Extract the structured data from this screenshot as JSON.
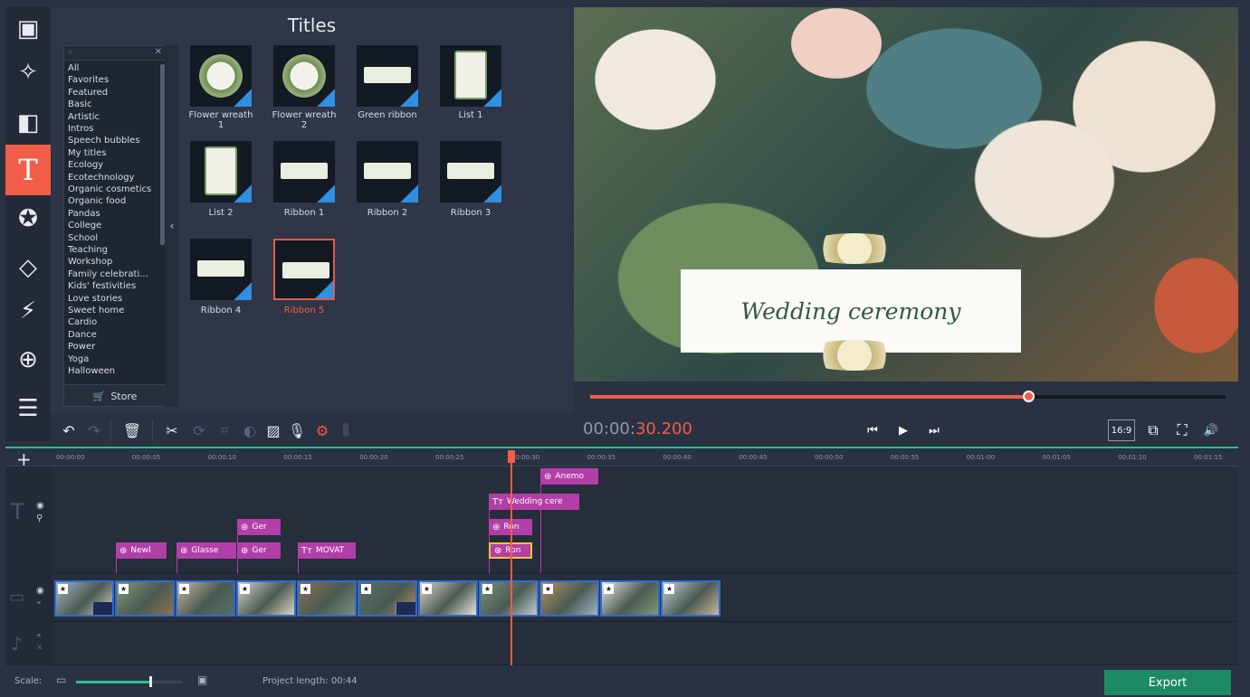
{
  "left_rail": {
    "items": [
      {
        "icon": "import-media-icon",
        "glyph": "▣"
      },
      {
        "icon": "magic-wand-icon",
        "glyph": "✧"
      },
      {
        "icon": "filters-icon",
        "glyph": "◧"
      },
      {
        "icon": "titles-icon",
        "glyph": "T",
        "active": true
      },
      {
        "icon": "stickers-icon",
        "glyph": "✪"
      },
      {
        "icon": "transitions-icon",
        "glyph": "◇"
      },
      {
        "icon": "motion-icon",
        "glyph": "⚡"
      },
      {
        "icon": "zoom-icon",
        "glyph": "⊕"
      },
      {
        "icon": "more-tools-icon",
        "glyph": "☰"
      }
    ]
  },
  "titles_panel": {
    "title": "Titles",
    "categories": [
      "All",
      "Favorites",
      "Featured",
      "Basic",
      "Artistic",
      "Intros",
      "Speech bubbles",
      "My titles",
      "Ecology",
      "Ecotechnology",
      "Organic cosmetics",
      "Organic food",
      "Pandas",
      "College",
      "School",
      "Teaching",
      "Workshop",
      "Family celebrati...",
      "Kids' festivities",
      "Love stories",
      "Sweet home",
      "Cardio",
      "Dance",
      "Power",
      "Yoga",
      "Halloween"
    ],
    "store_label": "Store",
    "collapse_glyph": "‹",
    "tiles": [
      {
        "label": "Flower wreath 1",
        "art": "wreath",
        "new": true
      },
      {
        "label": "Flower wreath 2",
        "art": "wreath",
        "new": true
      },
      {
        "label": "Green ribbon",
        "art": "ribbon",
        "new": true
      },
      {
        "label": "List 1",
        "art": "list",
        "new": true
      },
      {
        "label": "List 2",
        "art": "list",
        "new": true
      },
      {
        "label": "Ribbon 1",
        "art": "ribbon",
        "new": true
      },
      {
        "label": "Ribbon 2",
        "art": "ribbon",
        "new": true
      },
      {
        "label": "Ribbon 3",
        "art": "ribbon",
        "new": true
      },
      {
        "label": "Ribbon 4",
        "art": "ribbon",
        "new": true
      },
      {
        "label": "Ribbon 5",
        "art": "ribbon",
        "new": true,
        "selected": true
      }
    ]
  },
  "preview": {
    "title_text": "Wedding ceremony",
    "progress": 0.69
  },
  "toolbar": {
    "buttons": [
      {
        "name": "undo-icon",
        "glyph": "↶"
      },
      {
        "name": "redo-icon",
        "glyph": "↷",
        "dim": true
      },
      {
        "name": "delete-icon",
        "glyph": "🗑"
      },
      {
        "name": "cut-icon",
        "glyph": "✂",
        "sep": true
      },
      {
        "name": "rotate-icon",
        "glyph": "⟳",
        "dim": true
      },
      {
        "name": "crop-icon",
        "glyph": "⌗",
        "dim": true
      },
      {
        "name": "color-adjust-icon",
        "glyph": "◐",
        "dim": true
      },
      {
        "name": "image-icon",
        "glyph": "▨"
      },
      {
        "name": "microphone-icon",
        "glyph": "🎙"
      },
      {
        "name": "settings-gear-icon",
        "glyph": "⚙",
        "accent": true
      },
      {
        "name": "equalizer-icon",
        "glyph": "⫼",
        "dim": true
      }
    ]
  },
  "player": {
    "timecode_prefix": "00:00:",
    "timecode_highlight": "30.200",
    "prev_glyph": "⏮",
    "play_glyph": "▶",
    "next_glyph": "⏭",
    "aspect": "16:9",
    "detach_glyph": "⧉",
    "fullscreen_glyph": "⛶",
    "volume_glyph": "🔊"
  },
  "timeline": {
    "add_glyph": "+",
    "ruler_ticks": [
      "00:00:00",
      "00:00:05",
      "00:00:10",
      "00:00:15",
      "00:00:20",
      "00:00:25",
      "00:00:30",
      "00:00:35",
      "00:00:40",
      "00:00:45",
      "00:00:50",
      "00:00:55",
      "00:01:00",
      "00:01:05",
      "00:01:10",
      "00:01:15"
    ],
    "title_clips": [
      {
        "text": "Anemo",
        "kind": "sticker"
      },
      {
        "text": "Wedding cere",
        "kind": "title"
      },
      {
        "text": "Ron",
        "kind": "sticker"
      },
      {
        "text": "Ron",
        "kind": "sticker",
        "outlined": true
      },
      {
        "text": "Ger",
        "kind": "sticker"
      },
      {
        "text": "Ger",
        "kind": "sticker"
      },
      {
        "text": "Newl",
        "kind": "sticker"
      },
      {
        "text": "Glasse",
        "kind": "sticker"
      },
      {
        "text": "MOVAT",
        "kind": "title"
      }
    ],
    "video_clip_count": 11
  },
  "status": {
    "scale_label": "Scale:",
    "scale_value": 0.78,
    "project_length": "Project length: 00:44",
    "export_label": "Export"
  },
  "colors": {
    "accent": "#f15d48",
    "clip": "#b23fa8",
    "export": "#1e8a63",
    "teal": "#2bbf8a"
  }
}
